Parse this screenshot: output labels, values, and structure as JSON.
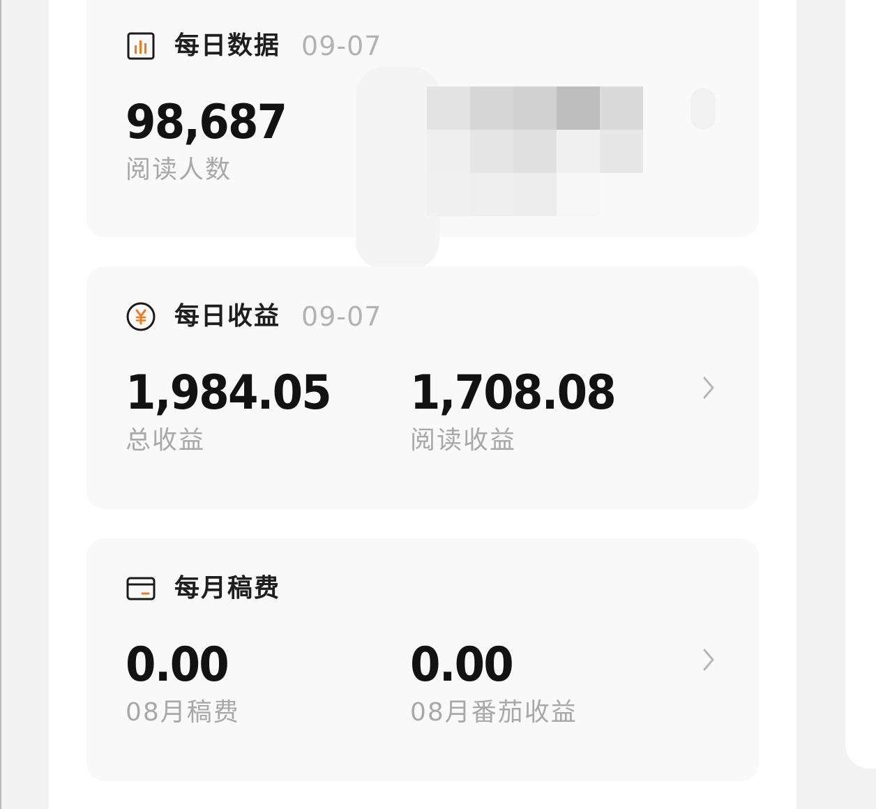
{
  "daily_data": {
    "title": "每日数据",
    "date": "09-07",
    "icon": "bar-chart-icon",
    "readers_value": "98,687",
    "readers_label": "阅读人数"
  },
  "daily_income": {
    "title": "每日收益",
    "date": "09-07",
    "icon": "yuan-coin-icon",
    "total_value": "1,984.05",
    "total_label": "总收益",
    "reading_value": "1,708.08",
    "reading_label": "阅读收益"
  },
  "monthly_fee": {
    "title": "每月稿费",
    "icon": "wallet-card-icon",
    "fee_value": "0.00",
    "fee_label": "08月稿费",
    "tomato_value": "0.00",
    "tomato_label": "08月番茄收益"
  },
  "colors": {
    "accent": "#f27a1a",
    "text_primary": "#121212",
    "text_secondary": "#a8a8a8",
    "card_bg": "#f9f9f9"
  }
}
